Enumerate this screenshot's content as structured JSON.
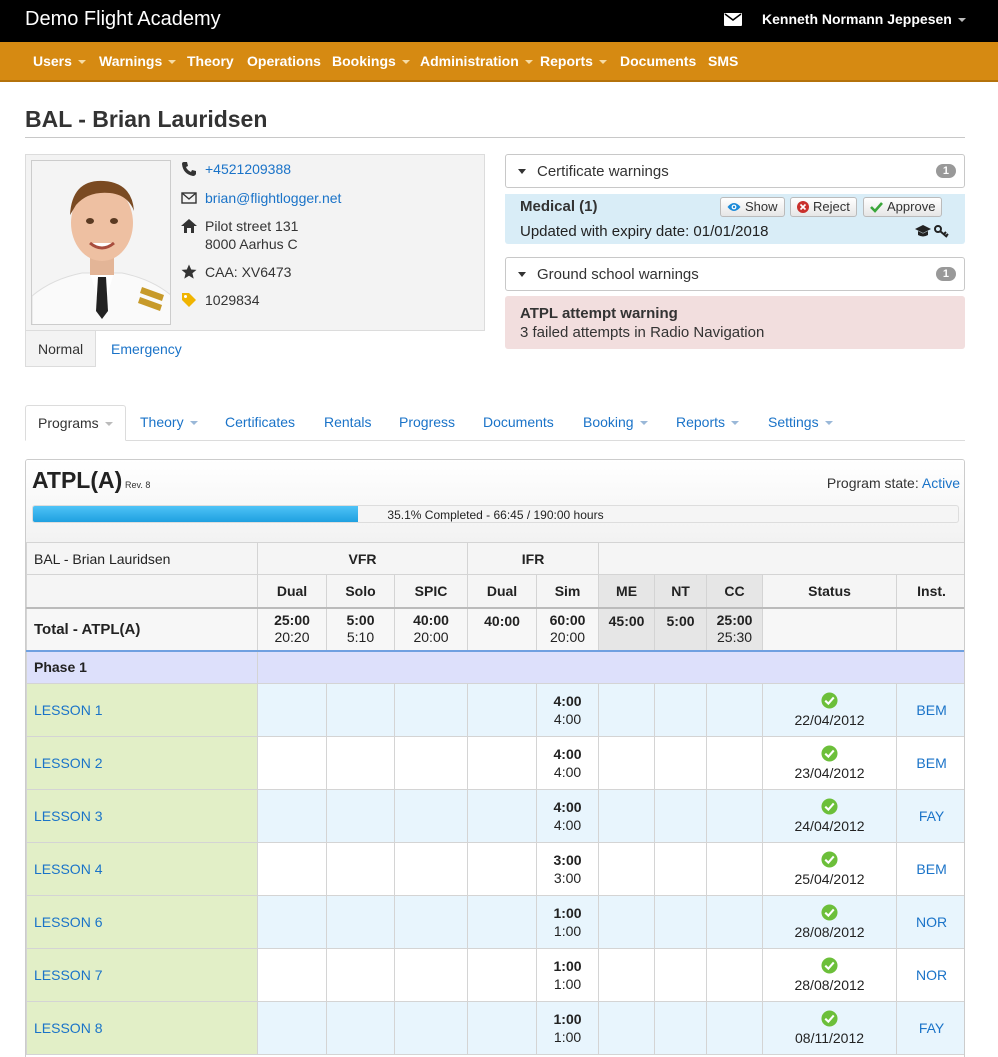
{
  "app": {
    "title": "Demo Flight Academy",
    "user": "Kenneth Normann Jeppesen"
  },
  "nav": [
    {
      "label": "Users",
      "dropdown": true
    },
    {
      "label": "Warnings",
      "dropdown": true
    },
    {
      "label": "Theory",
      "dropdown": false
    },
    {
      "label": "Operations",
      "dropdown": false
    },
    {
      "label": "Bookings",
      "dropdown": true
    },
    {
      "label": "Administration",
      "dropdown": true
    },
    {
      "label": "Reports",
      "dropdown": true
    },
    {
      "label": "Documents",
      "dropdown": false
    },
    {
      "label": "SMS",
      "dropdown": false
    }
  ],
  "page": {
    "title": "BAL - Brian Lauridsen"
  },
  "profile": {
    "phone": "+4521209388",
    "email": "brian@flightlogger.net",
    "address_line1": "Pilot street 131",
    "address_line2": "8000 Aarhus C",
    "caa": "CAA: XV6473",
    "tag": "1029834",
    "tabs": {
      "normal": "Normal",
      "emergency": "Emergency"
    }
  },
  "cert_warnings": {
    "label": "Certificate warnings",
    "count": "1",
    "item_title": "Medical (1)",
    "item_text": "Updated with expiry date: 01/01/2018",
    "show": "Show",
    "reject": "Reject",
    "approve": "Approve"
  },
  "ground_warnings": {
    "label": "Ground school warnings",
    "count": "1",
    "item_title": "ATPL attempt warning",
    "item_text": "3 failed attempts in Radio Navigation"
  },
  "main_tabs": [
    {
      "label": "Programs",
      "dropdown": true
    },
    {
      "label": "Theory",
      "dropdown": true
    },
    {
      "label": "Certificates",
      "dropdown": false
    },
    {
      "label": "Rentals",
      "dropdown": false
    },
    {
      "label": "Progress",
      "dropdown": false
    },
    {
      "label": "Documents",
      "dropdown": false
    },
    {
      "label": "Booking",
      "dropdown": true
    },
    {
      "label": "Reports",
      "dropdown": true
    },
    {
      "label": "Settings",
      "dropdown": true
    }
  ],
  "program": {
    "title": "ATPL(A)",
    "rev": "Rev. 8",
    "state_label": "Program state:",
    "state_value": "Active",
    "progress_fraction": 0.351,
    "progress_text": "35.1% Completed - 66:45 / 190:00 hours"
  },
  "table": {
    "student": "BAL - Brian Lauridsen",
    "groups": {
      "vfr": "VFR",
      "ifr": "IFR"
    },
    "columns": [
      "Dual",
      "Solo",
      "SPIC",
      "Dual",
      "Sim",
      "ME",
      "NT",
      "CC",
      "Status",
      "Inst."
    ],
    "total": {
      "label": "Total - ATPL(A)",
      "cells": [
        {
          "top": "25:00",
          "bottom": "20:20"
        },
        {
          "top": "5:00",
          "bottom": "5:10"
        },
        {
          "top": "40:00",
          "bottom": "20:00"
        },
        {
          "top": "40:00",
          "bottom": ""
        },
        {
          "top": "60:00",
          "bottom": "20:00"
        },
        {
          "top": "45:00",
          "bottom": ""
        },
        {
          "top": "5:00",
          "bottom": ""
        },
        {
          "top": "25:00",
          "bottom": "25:30"
        }
      ]
    },
    "phase": "Phase 1",
    "lessons": [
      {
        "name": "LESSON 1",
        "sim_top": "4:00",
        "sim_bottom": "4:00",
        "date": "22/04/2012",
        "inst": "BEM"
      },
      {
        "name": "LESSON 2",
        "sim_top": "4:00",
        "sim_bottom": "4:00",
        "date": "23/04/2012",
        "inst": "BEM"
      },
      {
        "name": "LESSON 3",
        "sim_top": "4:00",
        "sim_bottom": "4:00",
        "date": "24/04/2012",
        "inst": "FAY"
      },
      {
        "name": "LESSON 4",
        "sim_top": "3:00",
        "sim_bottom": "3:00",
        "date": "25/04/2012",
        "inst": "BEM"
      },
      {
        "name": "LESSON 6",
        "sim_top": "1:00",
        "sim_bottom": "1:00",
        "date": "28/08/2012",
        "inst": "NOR"
      },
      {
        "name": "LESSON 7",
        "sim_top": "1:00",
        "sim_bottom": "1:00",
        "date": "28/08/2012",
        "inst": "NOR"
      },
      {
        "name": "LESSON 8",
        "sim_top": "1:00",
        "sim_bottom": "1:00",
        "date": "08/11/2012",
        "inst": "FAY"
      }
    ]
  },
  "icons": {
    "mail": "mail-icon",
    "phone": "phone-icon",
    "envelope": "envelope-icon",
    "home": "home-icon",
    "star": "star-icon",
    "tag": "tag-icon",
    "eye": "eye-icon",
    "reject": "reject-icon",
    "approve": "check-icon",
    "graduation": "graduation-cap-icon",
    "key": "key-icon",
    "status": "check-circle-icon"
  },
  "colors": {
    "topbar": "#000000",
    "navbar": "#d68a12",
    "link": "#1a73c8",
    "info_box": "#d9edf7",
    "danger_box": "#f2dede",
    "lesson_col": "#e2efc7",
    "phase_row": "#dde0fb",
    "progress": "#1ea0e0",
    "status_ok": "#6cbf3a"
  }
}
